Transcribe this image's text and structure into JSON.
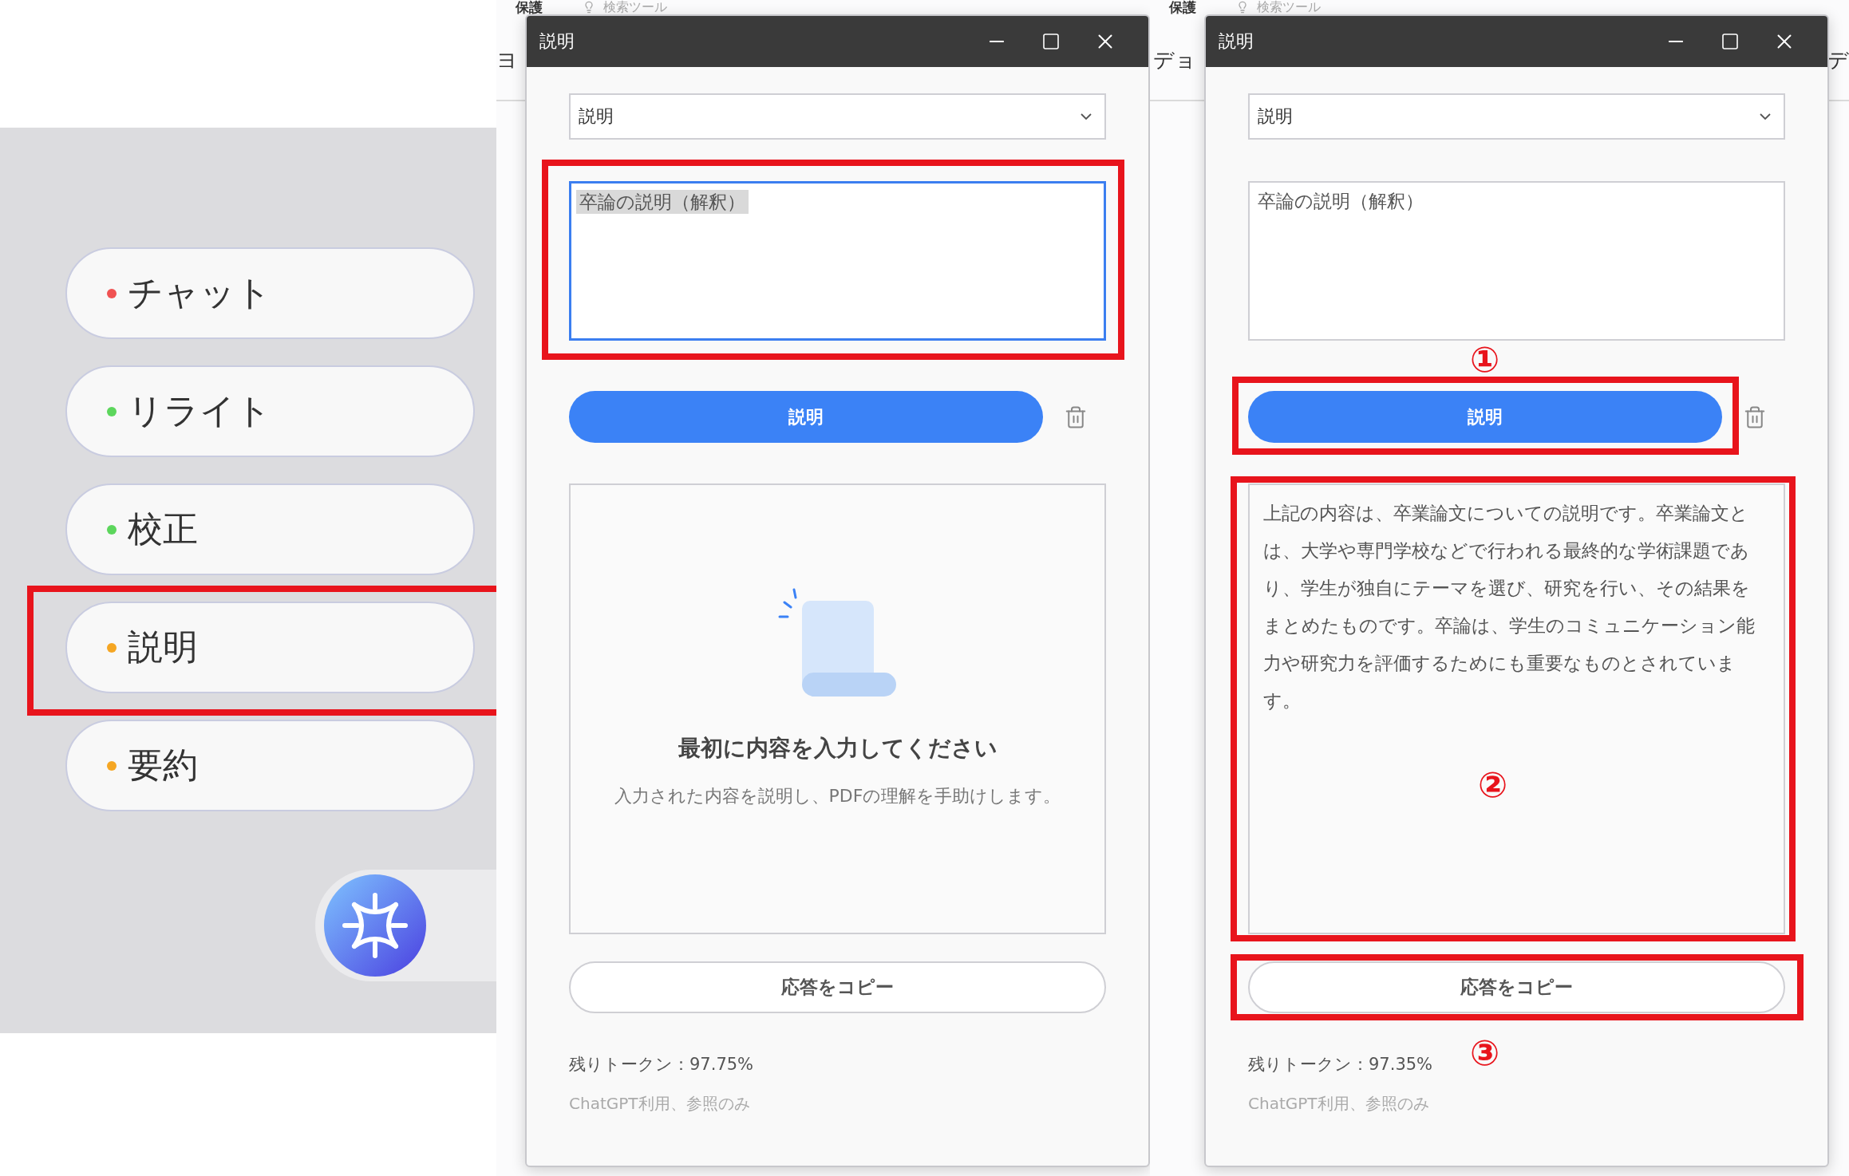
{
  "sidebar": {
    "items": [
      {
        "label": "チャット",
        "color": "#f05252",
        "highlighted": false
      },
      {
        "label": "リライト",
        "color": "#5cd65c",
        "highlighted": false
      },
      {
        "label": "校正",
        "color": "#5cd65c",
        "highlighted": false
      },
      {
        "label": "説明",
        "color": "#f5a623",
        "highlighted": true
      },
      {
        "label": "要約",
        "color": "#f5a623",
        "highlighted": false
      }
    ]
  },
  "backdrops": [
    {
      "heading": "保護",
      "tool": "検索ツール",
      "edge_text": "ヨ"
    },
    {
      "heading": "保護",
      "tool": "検索ツール",
      "edge_text": "デョ"
    }
  ],
  "trailing_edge_text": "デ",
  "windows": [
    {
      "title": "説明",
      "mode_select": {
        "value": "説明"
      },
      "input": {
        "value": "卒論の説明（解釈）",
        "focused": true,
        "text_selected": true,
        "highlighted": true
      },
      "action": {
        "label": "説明",
        "highlighted": false
      },
      "output": {
        "kind": "empty",
        "title": "最初に内容を入力してください",
        "description": "入力された内容を説明し、PDFの理解を手助けします。",
        "highlighted": false
      },
      "copy": {
        "label": "応答をコピー",
        "highlighted": false
      },
      "tokens": "残りトークン：97.75%",
      "note": "ChatGPT利用、参照のみ"
    },
    {
      "title": "説明",
      "mode_select": {
        "value": "説明"
      },
      "input": {
        "value": "卒論の説明（解釈）",
        "focused": false,
        "text_selected": false,
        "highlighted": false
      },
      "action": {
        "label": "説明",
        "highlighted": true,
        "marker": "①"
      },
      "output": {
        "kind": "text",
        "text": "上記の内容は、卒業論文についての説明です。卒業論文とは、大学や専門学校などで行われる最終的な学術課題であり、学生が独自にテーマを選び、研究を行い、その結果をまとめたものです。卒論は、学生のコミュニケーション能力や研究力を評価するためにも重要なものとされています。",
        "highlighted": true,
        "marker": "②"
      },
      "copy": {
        "label": "応答をコピー",
        "highlighted": true,
        "marker": "③"
      },
      "tokens": "残りトークン：97.35%",
      "note": "ChatGPT利用、参照のみ"
    }
  ]
}
